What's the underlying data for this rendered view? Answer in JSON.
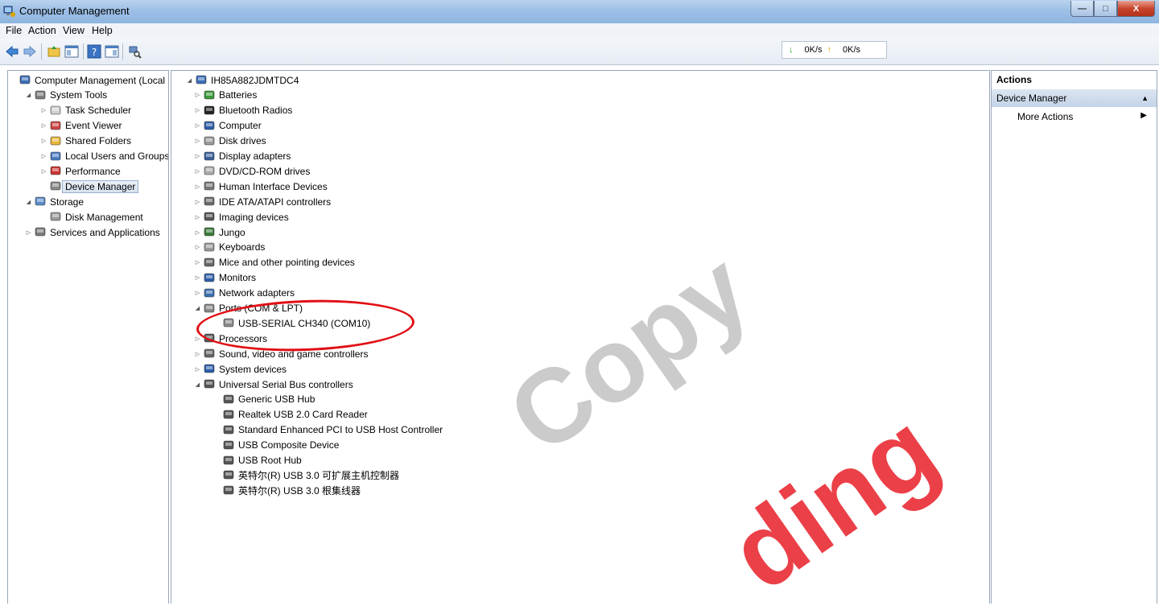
{
  "window": {
    "title": "Computer Management",
    "buttons": {
      "minimize": "—",
      "maximize": "□",
      "close": "X"
    }
  },
  "menu": [
    "File",
    "Action",
    "View",
    "Help"
  ],
  "network": {
    "down_label": "0K/s",
    "up_label": "0K/s"
  },
  "left_tree": [
    {
      "label": "Computer Management (Local",
      "level": 0,
      "expander": "",
      "icon": "computer-management-icon"
    },
    {
      "label": "System Tools",
      "level": 1,
      "expander": "◢",
      "icon": "system-tools-icon"
    },
    {
      "label": "Task Scheduler",
      "level": 2,
      "expander": "▷",
      "icon": "clock-icon"
    },
    {
      "label": "Event Viewer",
      "level": 2,
      "expander": "▷",
      "icon": "event-viewer-icon"
    },
    {
      "label": "Shared Folders",
      "level": 2,
      "expander": "▷",
      "icon": "shared-folder-icon"
    },
    {
      "label": "Local Users and Groups",
      "level": 2,
      "expander": "▷",
      "icon": "users-icon"
    },
    {
      "label": "Performance",
      "level": 2,
      "expander": "▷",
      "icon": "performance-icon"
    },
    {
      "label": "Device Manager",
      "level": 2,
      "expander": "",
      "icon": "device-manager-icon",
      "selected": true
    },
    {
      "label": "Storage",
      "level": 1,
      "expander": "◢",
      "icon": "storage-icon"
    },
    {
      "label": "Disk Management",
      "level": 2,
      "expander": "",
      "icon": "disk-icon"
    },
    {
      "label": "Services and Applications",
      "level": 1,
      "expander": "▷",
      "icon": "services-icon"
    }
  ],
  "device_tree": {
    "root": "IH85A882JDMTDC4",
    "categories": [
      {
        "label": "Batteries",
        "icon": "battery-icon"
      },
      {
        "label": "Bluetooth Radios",
        "icon": "bluetooth-icon"
      },
      {
        "label": "Computer",
        "icon": "computer-icon"
      },
      {
        "label": "Disk drives",
        "icon": "disk-drive-icon"
      },
      {
        "label": "Display adapters",
        "icon": "display-adapter-icon"
      },
      {
        "label": "DVD/CD-ROM drives",
        "icon": "dvd-icon"
      },
      {
        "label": "Human Interface Devices",
        "icon": "hid-icon"
      },
      {
        "label": "IDE ATA/ATAPI controllers",
        "icon": "ide-icon"
      },
      {
        "label": "Imaging devices",
        "icon": "imaging-icon"
      },
      {
        "label": "Jungo",
        "icon": "jungo-icon"
      },
      {
        "label": "Keyboards",
        "icon": "keyboard-icon"
      },
      {
        "label": "Mice and other pointing devices",
        "icon": "mouse-icon"
      },
      {
        "label": "Monitors",
        "icon": "monitor-icon"
      },
      {
        "label": "Network adapters",
        "icon": "network-icon"
      },
      {
        "label": "Ports (COM & LPT)",
        "icon": "port-icon",
        "expanded": true,
        "children": [
          "USB-SERIAL CH340 (COM10)"
        ]
      },
      {
        "label": "Processors",
        "icon": "processor-icon"
      },
      {
        "label": "Sound, video and game controllers",
        "icon": "sound-icon"
      },
      {
        "label": "System devices",
        "icon": "system-device-icon"
      },
      {
        "label": "Universal Serial Bus controllers",
        "icon": "usb-icon",
        "expanded": true,
        "children": [
          "Generic USB Hub",
          "Realtek USB 2.0 Card Reader",
          "Standard Enhanced PCI to USB Host Controller",
          "USB Composite Device",
          "USB Root Hub",
          "英特尔(R) USB 3.0 可扩展主机控制器",
          "英特尔(R) USB 3.0 根集线器"
        ]
      }
    ]
  },
  "actions": {
    "header": "Actions",
    "section": "Device Manager",
    "more": "More Actions"
  },
  "watermark": {
    "gray": "Copy",
    "red": "ding"
  },
  "colors": {
    "titlebar": "#9dbfe6",
    "annotation": "#e10f15",
    "selection": "#d6e2f0"
  }
}
